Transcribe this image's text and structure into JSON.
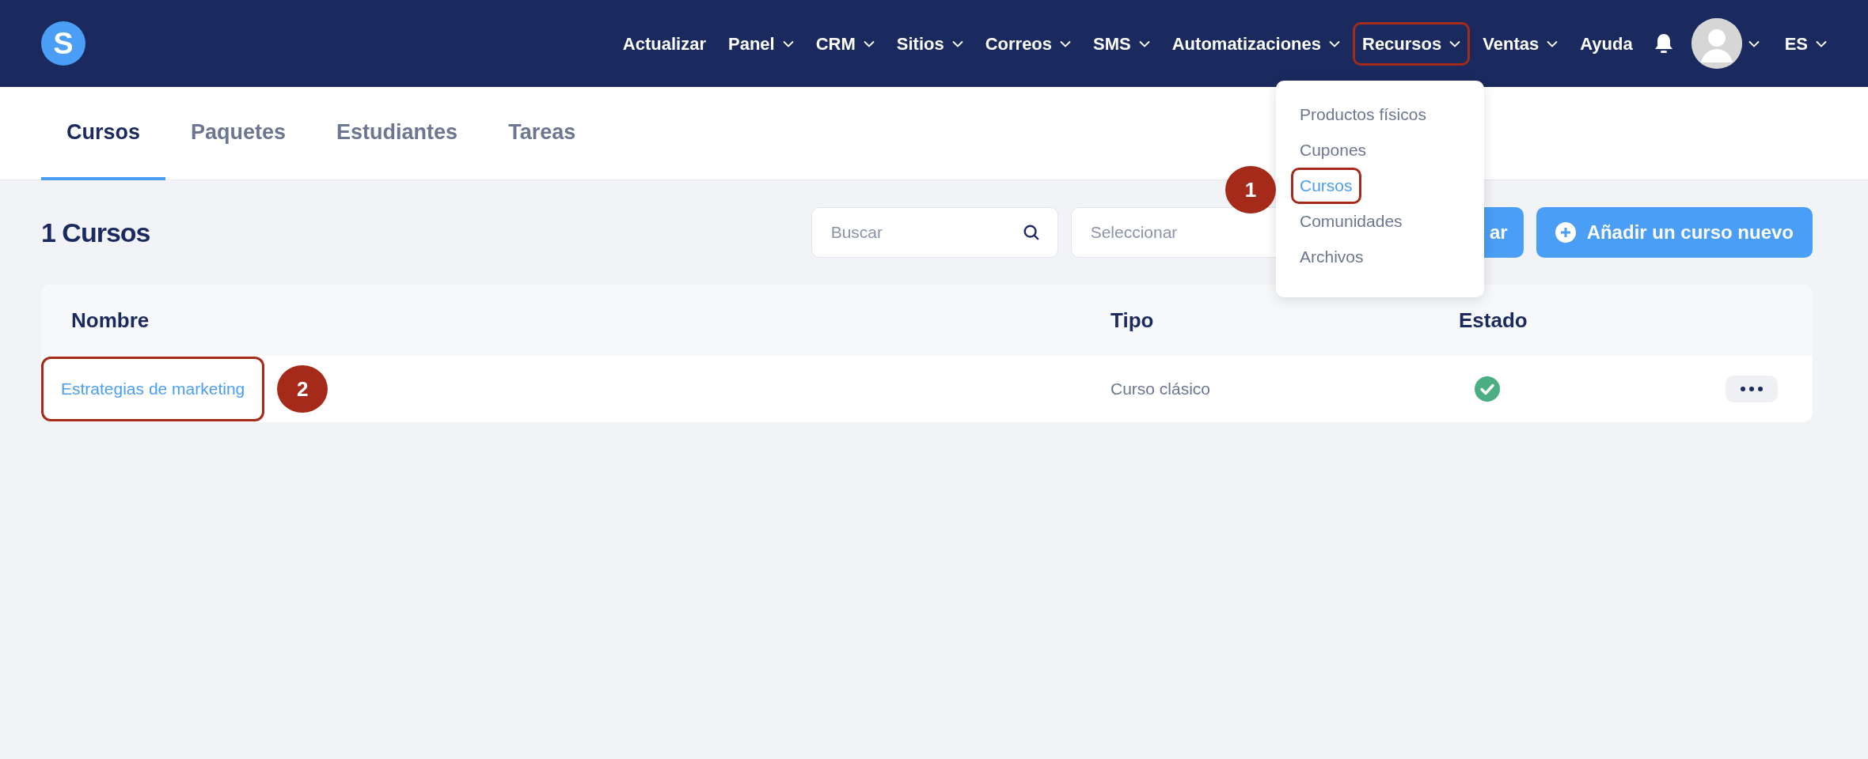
{
  "navbar": {
    "logo": "S",
    "items": [
      {
        "label": "Actualizar",
        "dropdown": false,
        "highlighted": false
      },
      {
        "label": "Panel",
        "dropdown": true,
        "highlighted": false
      },
      {
        "label": "CRM",
        "dropdown": true,
        "highlighted": false
      },
      {
        "label": "Sitios",
        "dropdown": true,
        "highlighted": false
      },
      {
        "label": "Correos",
        "dropdown": true,
        "highlighted": false
      },
      {
        "label": "SMS",
        "dropdown": true,
        "highlighted": false
      },
      {
        "label": "Automatizaciones",
        "dropdown": true,
        "highlighted": false
      },
      {
        "label": "Recursos",
        "dropdown": true,
        "highlighted": true
      },
      {
        "label": "Ventas",
        "dropdown": true,
        "highlighted": false
      },
      {
        "label": "Ayuda",
        "dropdown": false,
        "highlighted": false
      }
    ],
    "language": "ES"
  },
  "dropdown_menu": {
    "annotation": "1",
    "items": [
      {
        "label": "Productos físicos",
        "selected": false,
        "highlighted": false
      },
      {
        "label": "Cupones",
        "selected": false,
        "highlighted": false
      },
      {
        "label": "Cursos",
        "selected": true,
        "highlighted": true
      },
      {
        "label": "Comunidades",
        "selected": false,
        "highlighted": false
      },
      {
        "label": "Archivos",
        "selected": false,
        "highlighted": false
      }
    ]
  },
  "tabs": [
    {
      "label": "Cursos",
      "selected": true
    },
    {
      "label": "Paquetes",
      "selected": false
    },
    {
      "label": "Estudiantes",
      "selected": false
    },
    {
      "label": "Tareas",
      "selected": false
    }
  ],
  "page_title": "1 Cursos",
  "toolbar": {
    "search": {
      "placeholder": "Buscar"
    },
    "select": {
      "placeholder": "Seleccionar"
    },
    "hidden_button": "ar",
    "add_button": "Añadir un curso nuevo"
  },
  "table": {
    "columns": [
      "Nombre",
      "Tipo",
      "Estado"
    ],
    "rows": [
      {
        "name": "Estrategias de marketing",
        "highlighted": true,
        "annotation": "2",
        "type": "Curso clásico",
        "active": true
      }
    ]
  }
}
